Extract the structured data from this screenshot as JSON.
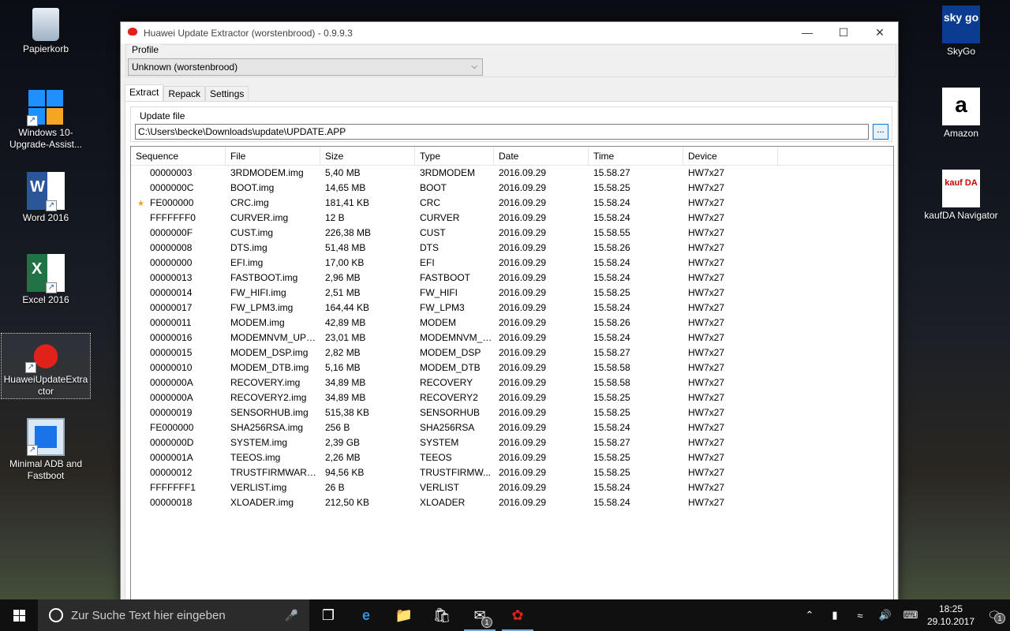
{
  "desktop": {
    "icons_left": [
      {
        "name": "recycle-bin",
        "label": "Papierkorb"
      },
      {
        "name": "windows-upgrade-assistant",
        "label": "Windows 10-Upgrade-Assist..."
      },
      {
        "name": "word-2016",
        "label": "Word 2016"
      },
      {
        "name": "excel-2016",
        "label": "Excel 2016"
      },
      {
        "name": "huawei-update-extractor",
        "label": "HuaweiUpdateExtractor"
      },
      {
        "name": "minimal-adb-fastboot",
        "label": "Minimal ADB and Fastboot"
      }
    ],
    "icons_right": [
      {
        "name": "skygo",
        "label": "SkyGo",
        "glyph": "sky go"
      },
      {
        "name": "amazon",
        "label": "Amazon",
        "glyph": "a"
      },
      {
        "name": "kaufda",
        "label": "kaufDA Navigator",
        "glyph": "kauf DA"
      }
    ]
  },
  "window": {
    "title": "Huawei Update Extractor (worstenbrood) - 0.9.9.3",
    "controls": {
      "minimize": "—",
      "maximize": "☐",
      "close": "✕"
    },
    "profile": {
      "label": "Profile",
      "value": "Unknown (worstenbrood)"
    },
    "tabs": [
      "Extract",
      "Repack",
      "Settings"
    ],
    "update_file": {
      "label": "Update file",
      "path": "C:\\Users\\becke\\Downloads\\update\\UPDATE.APP",
      "browse": "..."
    },
    "columns": [
      "Sequence",
      "File",
      "Size",
      "Type",
      "Date",
      "Time",
      "Device"
    ],
    "rows": [
      {
        "seq": "00000003",
        "file": "3RDMODEM.img",
        "size": "5,40 MB",
        "type": "3RDMODEM",
        "date": "2016.09.29",
        "time": "15.58.27",
        "device": "HW7x27",
        "star": ""
      },
      {
        "seq": "0000000C",
        "file": "BOOT.img",
        "size": "14,65 MB",
        "type": "BOOT",
        "date": "2016.09.29",
        "time": "15.58.25",
        "device": "HW7x27",
        "star": ""
      },
      {
        "seq": "FE000000",
        "file": "CRC.img",
        "size": "181,41 KB",
        "type": "CRC",
        "date": "2016.09.29",
        "time": "15.58.24",
        "device": "HW7x27",
        "star": "★"
      },
      {
        "seq": "FFFFFFF0",
        "file": "CURVER.img",
        "size": "12 B",
        "type": "CURVER",
        "date": "2016.09.29",
        "time": "15.58.24",
        "device": "HW7x27",
        "star": ""
      },
      {
        "seq": "0000000F",
        "file": "CUST.img",
        "size": "226,38 MB",
        "type": "CUST",
        "date": "2016.09.29",
        "time": "15.58.55",
        "device": "HW7x27",
        "star": ""
      },
      {
        "seq": "00000008",
        "file": "DTS.img",
        "size": "51,48 MB",
        "type": "DTS",
        "date": "2016.09.29",
        "time": "15.58.26",
        "device": "HW7x27",
        "star": ""
      },
      {
        "seq": "00000000",
        "file": "EFI.img",
        "size": "17,00 KB",
        "type": "EFI",
        "date": "2016.09.29",
        "time": "15.58.24",
        "device": "HW7x27",
        "star": ""
      },
      {
        "seq": "00000013",
        "file": "FASTBOOT.img",
        "size": "2,96 MB",
        "type": "FASTBOOT",
        "date": "2016.09.29",
        "time": "15.58.24",
        "device": "HW7x27",
        "star": ""
      },
      {
        "seq": "00000014",
        "file": "FW_HIFI.img",
        "size": "2,51 MB",
        "type": "FW_HIFI",
        "date": "2016.09.29",
        "time": "15.58.25",
        "device": "HW7x27",
        "star": ""
      },
      {
        "seq": "00000017",
        "file": "FW_LPM3.img",
        "size": "164,44 KB",
        "type": "FW_LPM3",
        "date": "2016.09.29",
        "time": "15.58.24",
        "device": "HW7x27",
        "star": ""
      },
      {
        "seq": "00000011",
        "file": "MODEM.img",
        "size": "42,89 MB",
        "type": "MODEM",
        "date": "2016.09.29",
        "time": "15.58.26",
        "device": "HW7x27",
        "star": ""
      },
      {
        "seq": "00000016",
        "file": "MODEMNVM_UPD...",
        "size": "23,01 MB",
        "type": "MODEMNVM_U...",
        "date": "2016.09.29",
        "time": "15.58.24",
        "device": "HW7x27",
        "star": ""
      },
      {
        "seq": "00000015",
        "file": "MODEM_DSP.img",
        "size": "2,82 MB",
        "type": "MODEM_DSP",
        "date": "2016.09.29",
        "time": "15.58.27",
        "device": "HW7x27",
        "star": ""
      },
      {
        "seq": "00000010",
        "file": "MODEM_DTB.img",
        "size": "5,16 MB",
        "type": "MODEM_DTB",
        "date": "2016.09.29",
        "time": "15.58.58",
        "device": "HW7x27",
        "star": ""
      },
      {
        "seq": "0000000A",
        "file": "RECOVERY.img",
        "size": "34,89 MB",
        "type": "RECOVERY",
        "date": "2016.09.29",
        "time": "15.58.58",
        "device": "HW7x27",
        "star": ""
      },
      {
        "seq": "0000000A",
        "file": "RECOVERY2.img",
        "size": "34,89 MB",
        "type": "RECOVERY2",
        "date": "2016.09.29",
        "time": "15.58.25",
        "device": "HW7x27",
        "star": ""
      },
      {
        "seq": "00000019",
        "file": "SENSORHUB.img",
        "size": "515,38 KB",
        "type": "SENSORHUB",
        "date": "2016.09.29",
        "time": "15.58.25",
        "device": "HW7x27",
        "star": ""
      },
      {
        "seq": "FE000000",
        "file": "SHA256RSA.img",
        "size": "256 B",
        "type": "SHA256RSA",
        "date": "2016.09.29",
        "time": "15.58.24",
        "device": "HW7x27",
        "star": ""
      },
      {
        "seq": "0000000D",
        "file": "SYSTEM.img",
        "size": "2,39 GB",
        "type": "SYSTEM",
        "date": "2016.09.29",
        "time": "15.58.27",
        "device": "HW7x27",
        "star": ""
      },
      {
        "seq": "0000001A",
        "file": "TEEOS.img",
        "size": "2,26 MB",
        "type": "TEEOS",
        "date": "2016.09.29",
        "time": "15.58.25",
        "device": "HW7x27",
        "star": ""
      },
      {
        "seq": "00000012",
        "file": "TRUSTFIRMWARE....",
        "size": "94,56 KB",
        "type": "TRUSTFIRMW...",
        "date": "2016.09.29",
        "time": "15.58.25",
        "device": "HW7x27",
        "star": ""
      },
      {
        "seq": "FFFFFFF1",
        "file": "VERLIST.img",
        "size": "26 B",
        "type": "VERLIST",
        "date": "2016.09.29",
        "time": "15.58.24",
        "device": "HW7x27",
        "star": ""
      },
      {
        "seq": "00000018",
        "file": "XLOADER.img",
        "size": "212,50 KB",
        "type": "XLOADER",
        "date": "2016.09.29",
        "time": "15.58.24",
        "device": "HW7x27",
        "star": ""
      }
    ]
  },
  "taskbar": {
    "search_placeholder": "Zur Suche Text hier eingeben",
    "mail_badge": "1",
    "time": "18:25",
    "date": "29.10.2017",
    "notification_badge": "1"
  },
  "colors": {
    "accent": "#0078d7",
    "huawei_red": "#e0221b",
    "taskbar": "#101010"
  }
}
